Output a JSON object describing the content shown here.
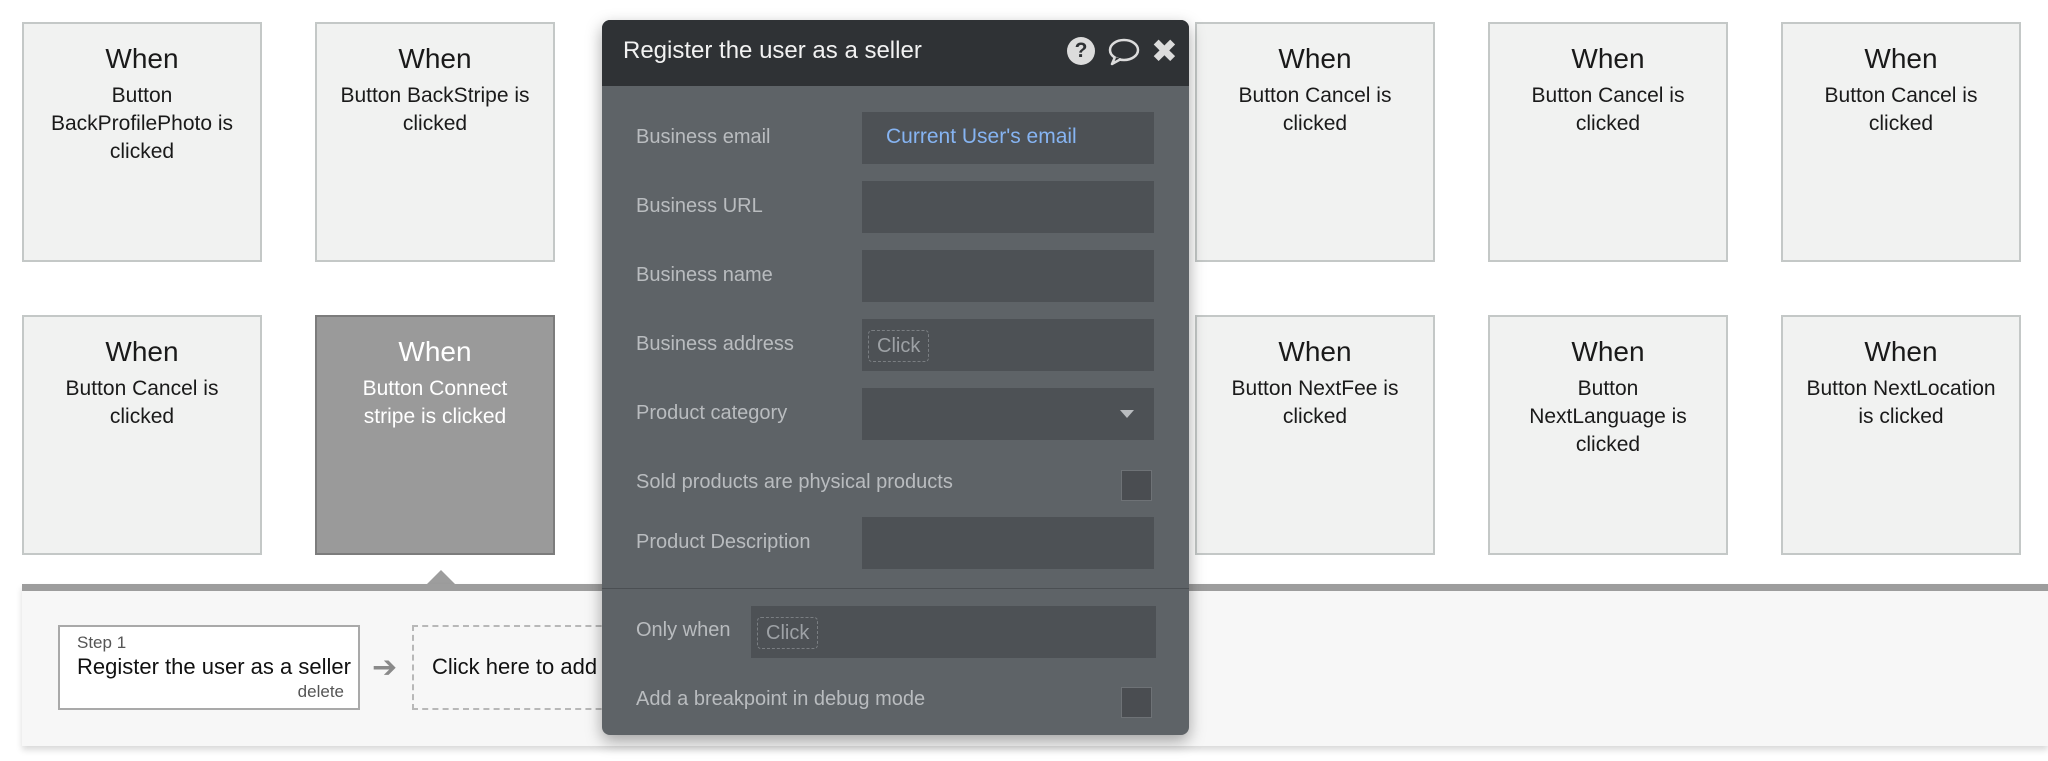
{
  "cards": [
    {
      "when": "When",
      "desc": "Button BackProfilePhoto is clicked"
    },
    {
      "when": "When",
      "desc": "Button BackStripe is clicked"
    },
    {
      "when": "When",
      "desc": "Button Cancel is clicked"
    },
    {
      "when": "When",
      "desc": "Button Cancel is clicked"
    },
    {
      "when": "When",
      "desc": "Button Cancel is clicked"
    },
    {
      "when": "When",
      "desc": "Button Cancel is clicked"
    },
    {
      "when": "When",
      "desc": "Button Connect stripe is clicked"
    },
    {
      "when": "When",
      "desc": "Button NextFee is clicked"
    },
    {
      "when": "When",
      "desc": "Button NextLanguage is clicked"
    },
    {
      "when": "When",
      "desc": "Button NextLocation is clicked"
    }
  ],
  "workflow": {
    "step_num": "Step 1",
    "step_title": "Register the user as a seller",
    "delete_label": "delete",
    "add_step_label": "Click here to add an action..."
  },
  "panel": {
    "title": "Register the user as a seller",
    "help_glyph": "?",
    "close_glyph": "✖",
    "fields": {
      "business_email_label": "Business email",
      "business_email_value": "Current User's email",
      "business_url_label": "Business URL",
      "business_name_label": "Business name",
      "business_address_label": "Business address",
      "business_address_chip": "Click",
      "product_category_label": "Product category",
      "physical_products_label": "Sold products are physical products",
      "product_description_label": "Product Description",
      "only_when_label": "Only when",
      "only_when_chip": "Click",
      "breakpoint_label": "Add a breakpoint in debug mode"
    }
  },
  "colors": {
    "panel_bg": "#5e6367",
    "panel_header": "#2f3235",
    "dynamic_value": "#86b4f2",
    "card_selected": "#9a9a9a"
  }
}
